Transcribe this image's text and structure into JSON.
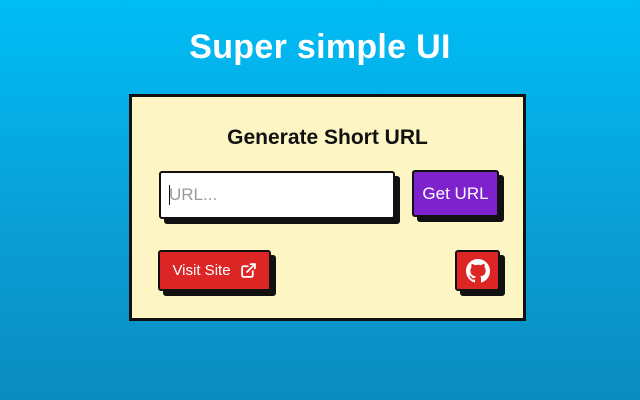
{
  "page": {
    "heading": "Super simple UI"
  },
  "card": {
    "title": "Generate Short URL",
    "url_input": {
      "value": "",
      "placeholder": "URL..."
    },
    "get_url_label": "Get URL",
    "visit_site_label": "Visit Site",
    "visit_site_icon": "external-link-icon",
    "github_icon": "github-icon"
  },
  "colors": {
    "background_top": "#00bdf6",
    "background_bottom": "#0b8cc0",
    "card_background": "#fdf6c4",
    "get_url_button": "#7e22ce",
    "red_buttons": "#dc2626",
    "border_shadow": "#111111"
  }
}
